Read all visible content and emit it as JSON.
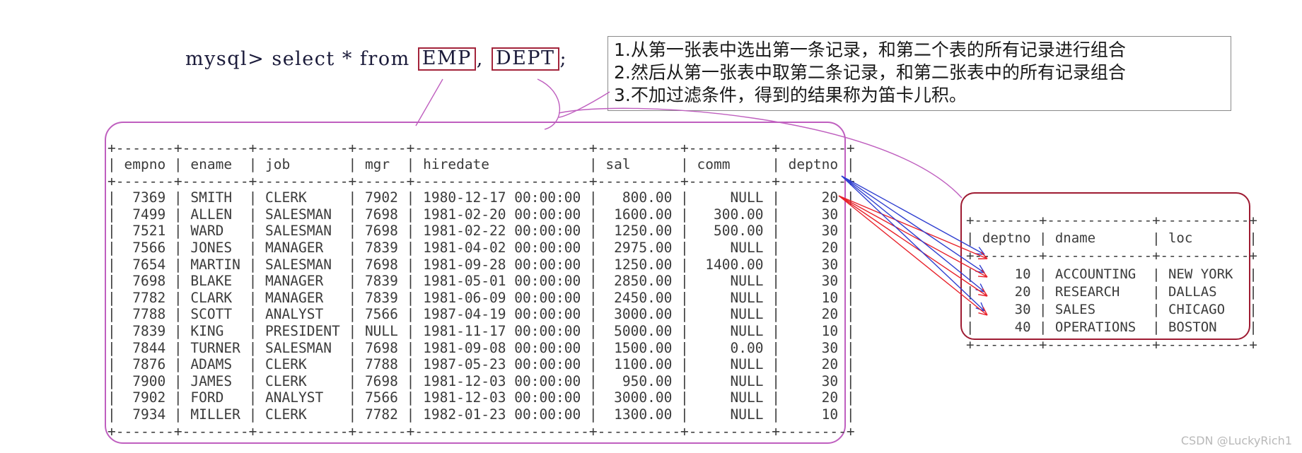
{
  "sql": {
    "prompt": "mysql> select * from ",
    "table1": "EMP",
    "separator": ", ",
    "table2": "DEPT",
    "terminator": ";"
  },
  "note": {
    "line1": "1.从第一张表中选出第一条记录，和第二个表的所有记录进行组合",
    "line2": "2.然后从第一张表中取第二条记录，和第二张表中的所有记录组合",
    "line3": "3.不加过滤条件，得到的结果称为笛卡儿积。"
  },
  "emp_table": {
    "name": "EMP",
    "columns": [
      "empno",
      "ename",
      "job",
      "mgr",
      "hiredate",
      "sal",
      "comm",
      "deptno"
    ],
    "widths": [
      7,
      8,
      11,
      6,
      21,
      10,
      10,
      8
    ],
    "aligns": [
      "right",
      "left",
      "left",
      "right",
      "left",
      "right",
      "right",
      "right"
    ],
    "rows": [
      [
        "7369",
        "SMITH",
        "CLERK",
        "7902",
        "1980-12-17 00:00:00",
        "800.00",
        "NULL",
        "20"
      ],
      [
        "7499",
        "ALLEN",
        "SALESMAN",
        "7698",
        "1981-02-20 00:00:00",
        "1600.00",
        "300.00",
        "30"
      ],
      [
        "7521",
        "WARD",
        "SALESMAN",
        "7698",
        "1981-02-22 00:00:00",
        "1250.00",
        "500.00",
        "30"
      ],
      [
        "7566",
        "JONES",
        "MANAGER",
        "7839",
        "1981-04-02 00:00:00",
        "2975.00",
        "NULL",
        "20"
      ],
      [
        "7654",
        "MARTIN",
        "SALESMAN",
        "7698",
        "1981-09-28 00:00:00",
        "1250.00",
        "1400.00",
        "30"
      ],
      [
        "7698",
        "BLAKE",
        "MANAGER",
        "7839",
        "1981-05-01 00:00:00",
        "2850.00",
        "NULL",
        "30"
      ],
      [
        "7782",
        "CLARK",
        "MANAGER",
        "7839",
        "1981-06-09 00:00:00",
        "2450.00",
        "NULL",
        "10"
      ],
      [
        "7788",
        "SCOTT",
        "ANALYST",
        "7566",
        "1987-04-19 00:00:00",
        "3000.00",
        "NULL",
        "20"
      ],
      [
        "7839",
        "KING",
        "PRESIDENT",
        "NULL",
        "1981-11-17 00:00:00",
        "5000.00",
        "NULL",
        "10"
      ],
      [
        "7844",
        "TURNER",
        "SALESMAN",
        "7698",
        "1981-09-08 00:00:00",
        "1500.00",
        "0.00",
        "30"
      ],
      [
        "7876",
        "ADAMS",
        "CLERK",
        "7788",
        "1987-05-23 00:00:00",
        "1100.00",
        "NULL",
        "20"
      ],
      [
        "7900",
        "JAMES",
        "CLERK",
        "7698",
        "1981-12-03 00:00:00",
        "950.00",
        "NULL",
        "30"
      ],
      [
        "7902",
        "FORD",
        "ANALYST",
        "7566",
        "1981-12-03 00:00:00",
        "3000.00",
        "NULL",
        "20"
      ],
      [
        "7934",
        "MILLER",
        "CLERK",
        "7782",
        "1982-01-23 00:00:00",
        "1300.00",
        "NULL",
        "10"
      ]
    ]
  },
  "dept_table": {
    "name": "DEPT",
    "columns": [
      "deptno",
      "dname",
      "loc"
    ],
    "widths": [
      8,
      13,
      11
    ],
    "aligns": [
      "right",
      "left",
      "left"
    ],
    "rows": [
      [
        "10",
        "ACCOUNTING",
        "NEW YORK"
      ],
      [
        "20",
        "RESEARCH",
        "DALLAS"
      ],
      [
        "30",
        "SALES",
        "CHICAGO"
      ],
      [
        "40",
        "OPERATIONS",
        "BOSTON"
      ]
    ]
  },
  "colors": {
    "sql_text": "#1b1b3a",
    "box_highlight": "#a3243b",
    "note_border": "#8a8a8a",
    "emp_outline": "#bf5fbf",
    "dept_outline": "#9e1b32",
    "arrow_first_row": "#2f3fd0",
    "arrow_second_row": "#e8212a",
    "leader_line": "#bf5fbf",
    "watermark": "#b9b9b9"
  },
  "watermark": "CSDN @LuckyRich1"
}
